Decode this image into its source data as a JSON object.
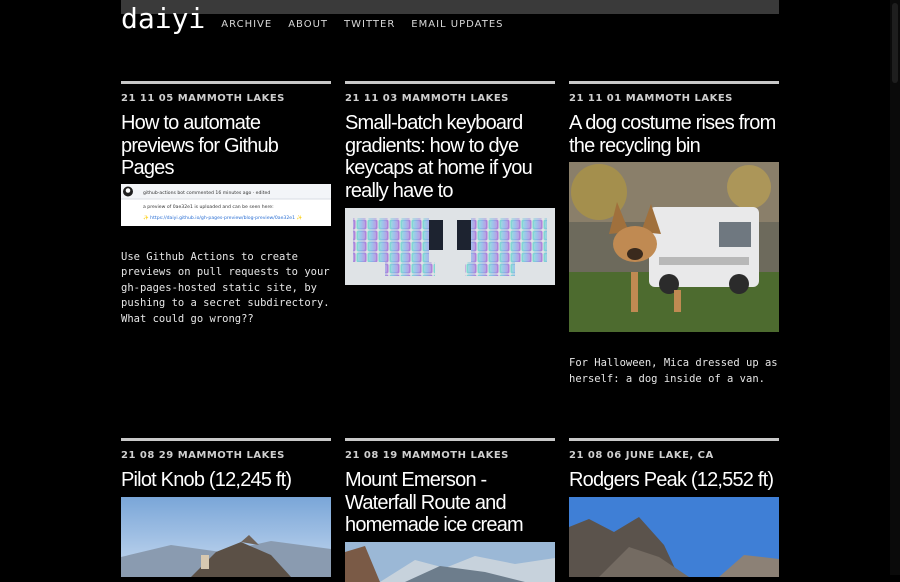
{
  "site": {
    "logo": "daiyi"
  },
  "nav": [
    "ARCHIVE",
    "ABOUT",
    "TWITTER",
    "EMAIL UPDATES"
  ],
  "posts": [
    {
      "meta": "21 11 05 MAMMOTH LAKES",
      "title": "How to automate previews for Github Pages",
      "image": {
        "icon": "github-icon",
        "line1": "github-actions  bot commented 16 minutes ago · edited",
        "line2": "a preview of  0ae32e1  is uploaded and can be seen here:",
        "line3": "✨ https://daiyi.github.io/gh-pages-preview/blog-preview/0ae32e1 ✨"
      },
      "description": "Use Github Actions to create previews on pull requests to your gh-pages-hosted static site, by pushing to a secret subdirectory. What could go wrong??"
    },
    {
      "meta": "21 11 03 MAMMOTH LAKES",
      "title": "Small-batch keyboard gradients: how to dye keycaps at home if you really have to",
      "description": ""
    },
    {
      "meta": "21 11 01 MAMMOTH LAKES",
      "title": "A dog costume rises from the recycling bin",
      "description": "For Halloween, Mica dressed up as herself: a dog inside of a van."
    },
    {
      "meta": "21 08 29 MAMMOTH LAKES",
      "title": "Pilot Knob (12,245 ft)",
      "description": ""
    },
    {
      "meta": "21 08 19 MAMMOTH LAKES",
      "title": "Mount Emerson - Waterfall Route and homemade ice cream",
      "description": ""
    },
    {
      "meta": "21 08 06 JUNE LAKE, CA",
      "title": "Rodgers Peak (12,552 ft)",
      "description": ""
    }
  ],
  "colors": {
    "background": "#000000",
    "text": "#ffffff",
    "rule": "#c8c8c8",
    "topbar": "#3a3a3a"
  }
}
